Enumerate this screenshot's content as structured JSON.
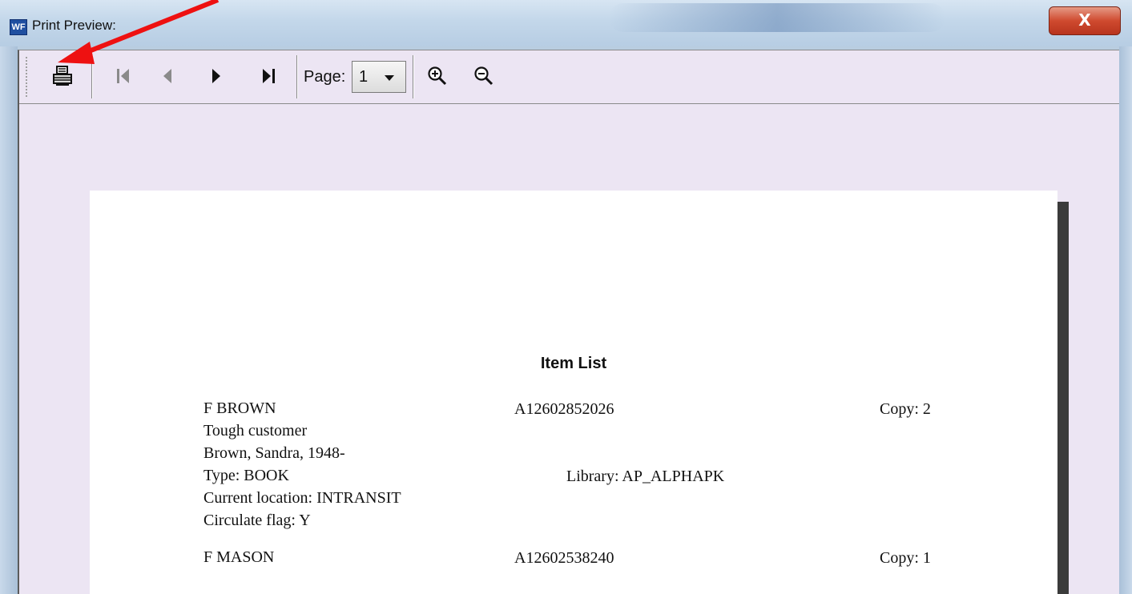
{
  "window": {
    "title": "Print Preview:",
    "app_icon_text": "WF",
    "close_symbol": "X"
  },
  "toolbar": {
    "print_icon": "printer-icon",
    "first_icon": "first-page-icon",
    "prev_icon": "prev-page-icon",
    "next_icon": "next-page-icon",
    "last_icon": "last-page-icon",
    "page_label": "Page:",
    "page_value": "1",
    "zoom_in_icon": "zoom-in-icon",
    "zoom_out_icon": "zoom-out-icon"
  },
  "document": {
    "title": "Item List",
    "records": [
      {
        "call_number": "F BROWN",
        "item_id": "A12602852026",
        "copy": "Copy: 2",
        "title": "Tough customer",
        "author": "Brown, Sandra, 1948-",
        "type": "Type: BOOK",
        "library": "Library: AP_ALPHAPK",
        "location": "Current location: INTRANSIT",
        "circulate": "Circulate flag: Y"
      },
      {
        "call_number": "F MASON",
        "item_id": "A12602538240",
        "copy": "Copy: 1"
      }
    ]
  },
  "colors": {
    "annotation_arrow": "#ee1111",
    "toolbar_bg": "#ece5f3",
    "close_button": "#cf4a2f"
  }
}
